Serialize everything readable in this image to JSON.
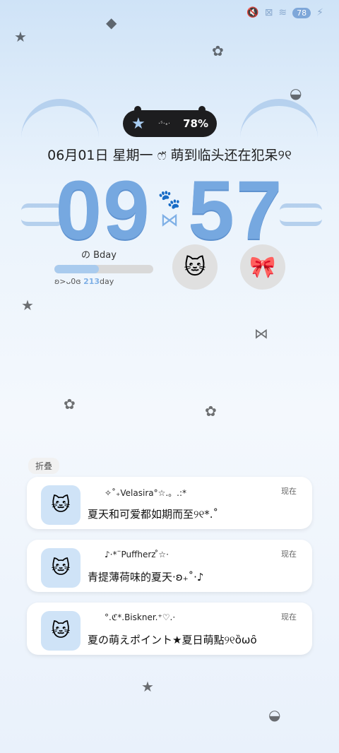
{
  "status": {
    "battery_badge": "78"
  },
  "pill": {
    "dots": "·ˢ·˖·",
    "percent": "78%"
  },
  "lockscreen": {
    "date": "06月01日 星期一 ෆ̈ 萌到临头还在犯呆୨୧",
    "hour": "09",
    "minute": "57"
  },
  "bday_widget": {
    "title": "の Bday",
    "prefix": "ʚ>ᴗ0ɞ",
    "count": "213",
    "unit": "day",
    "progress": 0.45
  },
  "notifications": {
    "fold_label": "折叠",
    "items": [
      {
        "sender": "✧˚₊Velasira°☆.。.:*",
        "message": "夏天和可爱都如期而至୨୧*.˚",
        "time": "现在"
      },
      {
        "sender": "♪·*¨Puffherz ̊☆·",
        "message": "青提薄荷味的夏天·ʚ₊˚·♪",
        "time": "现在"
      },
      {
        "sender": "°.ℭ*.Biskner.⁺♡.·",
        "message": "夏の萌えポイント★夏日萌點୨୧ȍωȏ",
        "time": "现在"
      }
    ]
  },
  "colors": {
    "accent": "#76a8e0",
    "pill": "#1d1d1f"
  }
}
